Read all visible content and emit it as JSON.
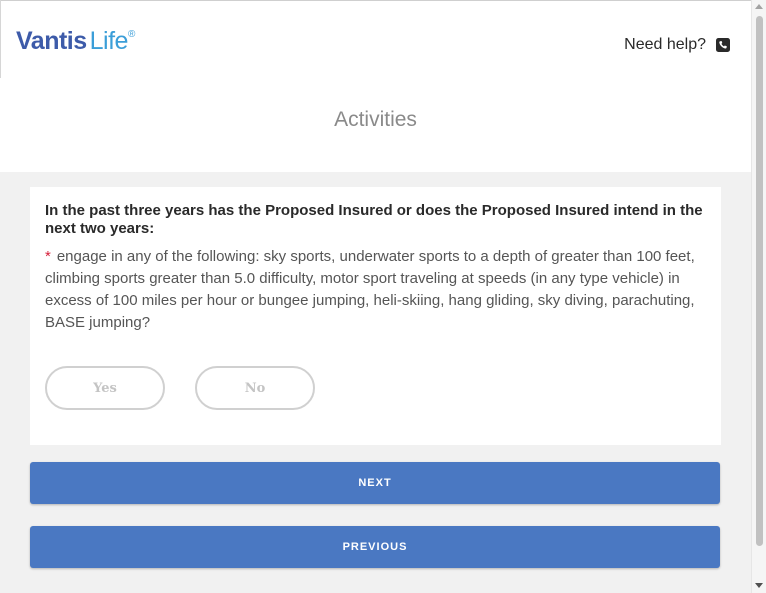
{
  "header": {
    "logo": {
      "brand": "Vantis",
      "product": "Life",
      "mark": "®"
    },
    "help_label": "Need help?",
    "help_icon": "phone-icon"
  },
  "page": {
    "title": "Activities"
  },
  "question": {
    "heading": "In the past three years has the Proposed Insured or does the Proposed Insured intend in the next two years:",
    "required_mark": "*",
    "text": "engage in any of the following: sky sports, underwater sports to a depth of greater than 100 feet, climbing sports greater than 5.0 difficulty, motor sport traveling at speeds (in any type vehicle) in excess of 100 miles per hour or bungee jumping, heli-skiing, hang gliding, sky diving, parachuting, BASE jumping?",
    "options": {
      "yes": "Yes",
      "no": "No"
    }
  },
  "actions": {
    "next": "NEXT",
    "previous": "PREVIOUS"
  },
  "colors": {
    "brand": "#3d5ba9",
    "accent": "#3b9ed8",
    "button": "#4a78c2",
    "required": "#d61f3a"
  }
}
